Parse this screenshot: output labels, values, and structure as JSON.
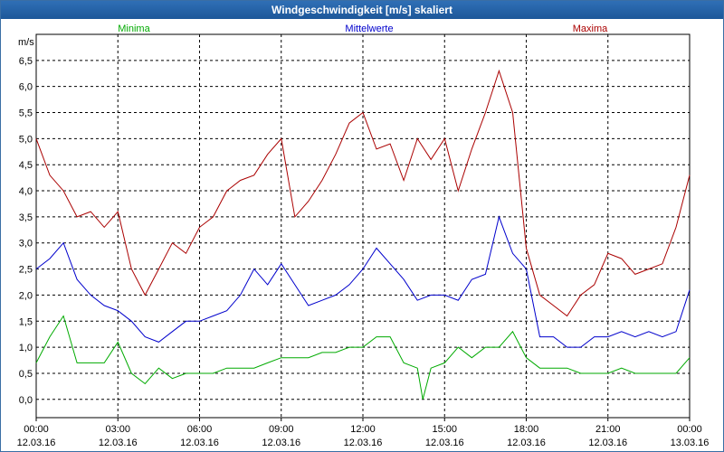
{
  "window": {
    "title": "Windgeschwindigkeit [m/s] skaliert"
  },
  "chart_data": {
    "type": "line",
    "ylabel": "m/s",
    "ylim": [
      -0.35,
      7.0
    ],
    "yticks": [
      "0,0",
      "0,5",
      "1,0",
      "1,5",
      "2,0",
      "2,5",
      "3,0",
      "3,5",
      "4,0",
      "4,5",
      "5,0",
      "5,5",
      "6,0",
      "6,5"
    ],
    "xlim": [
      0,
      24
    ],
    "xticks": [
      {
        "time": "00:00",
        "date": "12.03.16"
      },
      {
        "time": "03:00",
        "date": "12.03.16"
      },
      {
        "time": "06:00",
        "date": "12.03.16"
      },
      {
        "time": "09:00",
        "date": "12.03.16"
      },
      {
        "time": "12:00",
        "date": "12.03.16"
      },
      {
        "time": "15:00",
        "date": "12.03.16"
      },
      {
        "time": "18:00",
        "date": "12.03.16"
      },
      {
        "time": "21:00",
        "date": "12.03.16"
      },
      {
        "time": "00:00",
        "date": "13.03.16"
      }
    ],
    "grid": true,
    "legend_position": "top",
    "series": [
      {
        "name": "Minima",
        "color": "#00aa00",
        "x": [
          0,
          0.5,
          1,
          1.5,
          2,
          2.5,
          3,
          3.5,
          4,
          4.5,
          5,
          5.5,
          6,
          6.5,
          7,
          7.5,
          8,
          8.5,
          9,
          9.5,
          10,
          10.5,
          11,
          11.5,
          12,
          12.5,
          13,
          13.5,
          14,
          14.2,
          14.5,
          15,
          15.5,
          16,
          16.5,
          17,
          17.5,
          18,
          18.5,
          19,
          19.5,
          20,
          20.5,
          21,
          21.5,
          22,
          22.5,
          23,
          23.5,
          24
        ],
        "values": [
          0.7,
          1.2,
          1.6,
          0.7,
          0.7,
          0.7,
          1.1,
          0.5,
          0.3,
          0.6,
          0.4,
          0.5,
          0.5,
          0.5,
          0.6,
          0.6,
          0.6,
          0.7,
          0.8,
          0.8,
          0.8,
          0.9,
          0.9,
          1.0,
          1.0,
          1.2,
          1.2,
          0.7,
          0.6,
          0.0,
          0.6,
          0.7,
          1.0,
          0.8,
          1.0,
          1.0,
          1.3,
          0.8,
          0.6,
          0.6,
          0.6,
          0.5,
          0.5,
          0.5,
          0.6,
          0.5,
          0.5,
          0.5,
          0.5,
          0.8
        ]
      },
      {
        "name": "Mittelwerte",
        "color": "#0000cc",
        "x": [
          0,
          0.5,
          1,
          1.5,
          2,
          2.5,
          3,
          3.5,
          4,
          4.5,
          5,
          5.5,
          6,
          6.5,
          7,
          7.5,
          8,
          8.5,
          9,
          9.5,
          10,
          10.5,
          11,
          11.5,
          12,
          12.5,
          13,
          13.5,
          14,
          14.5,
          15,
          15.5,
          16,
          16.5,
          17,
          17.5,
          18,
          18.5,
          19,
          19.5,
          20,
          20.5,
          21,
          21.5,
          22,
          22.5,
          23,
          23.5,
          24
        ],
        "values": [
          2.5,
          2.7,
          3.0,
          2.3,
          2.0,
          1.8,
          1.7,
          1.5,
          1.2,
          1.1,
          1.3,
          1.5,
          1.5,
          1.6,
          1.7,
          2.0,
          2.5,
          2.2,
          2.6,
          2.2,
          1.8,
          1.9,
          2.0,
          2.2,
          2.5,
          2.9,
          2.6,
          2.3,
          1.9,
          2.0,
          2.0,
          1.9,
          2.3,
          2.4,
          3.5,
          2.8,
          2.5,
          1.2,
          1.2,
          1.0,
          1.0,
          1.2,
          1.2,
          1.3,
          1.2,
          1.3,
          1.2,
          1.3,
          2.1
        ]
      },
      {
        "name": "Maxima",
        "color": "#aa0000",
        "x": [
          0,
          0.5,
          1,
          1.5,
          2,
          2.5,
          3,
          3.5,
          4,
          4.5,
          5,
          5.5,
          6,
          6.5,
          7,
          7.5,
          8,
          8.5,
          9,
          9.5,
          10,
          10.5,
          11,
          11.5,
          12,
          12.5,
          13,
          13.5,
          14,
          14.5,
          15,
          15.5,
          16,
          16.5,
          17,
          17.5,
          18,
          18.5,
          19,
          19.5,
          20,
          20.5,
          21,
          21.5,
          22,
          22.5,
          23,
          23.5,
          24
        ],
        "values": [
          5.0,
          4.3,
          4.0,
          3.5,
          3.6,
          3.3,
          3.6,
          2.5,
          2.0,
          2.5,
          3.0,
          2.8,
          3.3,
          3.5,
          4.0,
          4.2,
          4.3,
          4.7,
          5.0,
          3.5,
          3.8,
          4.2,
          4.7,
          5.3,
          5.5,
          4.8,
          4.9,
          4.2,
          5.0,
          4.6,
          5.0,
          4.0,
          4.8,
          5.5,
          6.3,
          5.5,
          2.9,
          2.0,
          1.8,
          1.6,
          2.0,
          2.2,
          2.8,
          2.7,
          2.4,
          2.5,
          2.6,
          3.3,
          4.3
        ]
      }
    ]
  }
}
